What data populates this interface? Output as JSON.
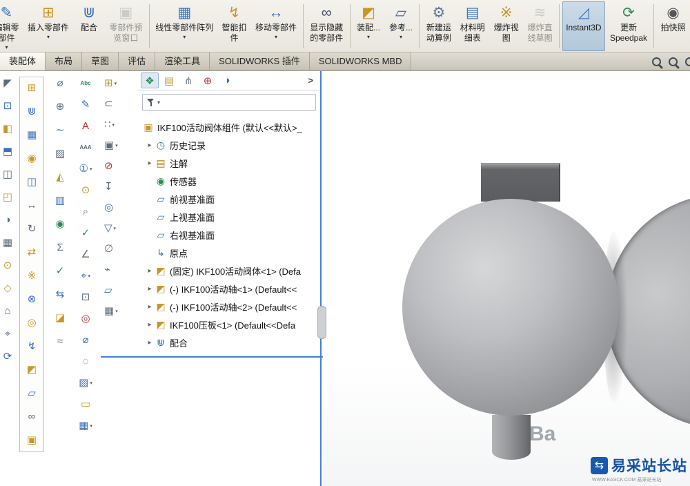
{
  "ribbon": {
    "buttons": [
      {
        "name": "edit-component",
        "label": "编辑零部件",
        "lines": [
          "编辑零",
          "部件"
        ],
        "glyph": "✎",
        "color": "#3a6ebc",
        "arrow": true
      },
      {
        "name": "insert-components",
        "label": "插入零部件",
        "lines": [
          "插入零部件"
        ],
        "glyph": "⊞",
        "color": "#c8962a",
        "arrow": true
      },
      {
        "name": "mate",
        "label": "配合",
        "lines": [
          "配合"
        ],
        "glyph": "⋓",
        "color": "#3a6ebc",
        "arrow": false
      },
      {
        "name": "component-preview-window",
        "label": "零部件预览窗口",
        "lines": [
          "零部件预",
          "览窗口"
        ],
        "glyph": "▣",
        "color": "#9aa0a6",
        "arrow": false,
        "disabled": true
      },
      {
        "name": "linear-component-pattern",
        "label": "线性零部件阵列",
        "lines": [
          "线性零部件阵列"
        ],
        "glyph": "▦",
        "color": "#3a6ebc",
        "arrow": true
      },
      {
        "name": "smart-fasteners",
        "label": "智能扣件",
        "lines": [
          "智能扣",
          "件"
        ],
        "glyph": "↯",
        "color": "#c8962a",
        "arrow": false
      },
      {
        "name": "move-component",
        "label": "移动零部件",
        "lines": [
          "移动零部件"
        ],
        "glyph": "↔",
        "color": "#3a6ebc",
        "arrow": true
      },
      {
        "name": "show-hidden-components",
        "label": "显示隐藏的零部件",
        "lines": [
          "显示隐藏",
          "的零部件"
        ],
        "glyph": "∞",
        "color": "#44506a",
        "arrow": false
      },
      {
        "name": "assembly-features",
        "label": "装配...",
        "lines": [
          "装配..."
        ],
        "glyph": "◩",
        "color": "#c8962a",
        "arrow": true
      },
      {
        "name": "reference-geometry",
        "label": "参考...",
        "lines": [
          "参考..."
        ],
        "glyph": "▱",
        "color": "#3a6ebc",
        "arrow": true
      },
      {
        "name": "new-motion-study",
        "label": "新建运动算例",
        "lines": [
          "新建运",
          "动算例"
        ],
        "glyph": "⚙",
        "color": "#5b7a9a",
        "arrow": false
      },
      {
        "name": "bill-of-materials",
        "label": "材料明细表",
        "lines": [
          "材料明",
          "细表"
        ],
        "glyph": "▤",
        "color": "#3a6ebc",
        "arrow": false
      },
      {
        "name": "exploded-view",
        "label": "爆炸视图",
        "lines": [
          "爆炸视",
          "图"
        ],
        "glyph": "※",
        "color": "#c8962a",
        "arrow": false
      },
      {
        "name": "explode-line-sketch",
        "label": "爆炸直线草图",
        "lines": [
          "爆炸直",
          "线草图"
        ],
        "glyph": "≋",
        "color": "#9aa0a6",
        "arrow": false,
        "disabled": true
      },
      {
        "name": "instant3d",
        "label": "Instant3D",
        "lines": [
          "Instant3D"
        ],
        "glyph": "◿",
        "color": "#3a6ebc",
        "arrow": false,
        "active": true
      },
      {
        "name": "update-speedpak",
        "label": "更新 Speedpak",
        "lines": [
          "更新",
          "Speedpak"
        ],
        "glyph": "⟳",
        "color": "#2e8b57",
        "arrow": false
      },
      {
        "name": "take-snapshot",
        "label": "拍快照",
        "lines": [
          "拍快照"
        ],
        "glyph": "◉",
        "color": "#555555",
        "arrow": false
      }
    ],
    "separators_after": [
      3,
      6,
      7,
      9,
      13,
      15
    ]
  },
  "tabs": {
    "items": [
      {
        "name": "assembly",
        "label": "装配体",
        "active": true
      },
      {
        "name": "layout",
        "label": "布局",
        "active": false
      },
      {
        "name": "sketch",
        "label": "草图",
        "active": false
      },
      {
        "name": "evaluate",
        "label": "评估",
        "active": false
      },
      {
        "name": "render-tools",
        "label": "渲染工具",
        "active": false
      },
      {
        "name": "solidworks-addins",
        "label": "SOLIDWORKS 插件",
        "active": false
      },
      {
        "name": "solidworks-mbd",
        "label": "SOLIDWORKS MBD",
        "active": false
      }
    ],
    "right_icons": [
      {
        "name": "search-commands"
      },
      {
        "name": "zoom-magnifier"
      },
      {
        "name": "magnify-partial"
      }
    ]
  },
  "left_toolbars": {
    "col_a": [
      {
        "n": "select-tool",
        "g": "◤",
        "c": "#5b6b7b"
      },
      {
        "n": "zoom-to-fit",
        "g": "⊡",
        "c": "#3a6ebc"
      },
      {
        "n": "section-view",
        "g": "◧",
        "c": "#c8962a"
      },
      {
        "n": "view-orientation",
        "g": "⬒",
        "c": "#3a6ebc"
      },
      {
        "n": "display-style",
        "g": "◫",
        "c": "#5b6b7b"
      },
      {
        "n": "hide-components",
        "g": "◰",
        "c": "#c8962a"
      },
      {
        "n": "appearance",
        "g": "◑",
        "c": "#3a6ebc"
      },
      {
        "n": "scene",
        "g": "▦",
        "c": "#5b6b7b"
      },
      {
        "n": "camera-views",
        "g": "⊙",
        "c": "#c8962a"
      },
      {
        "n": "lights",
        "g": "◇",
        "c": "#c8962a"
      },
      {
        "n": "standard-views",
        "g": "⌂",
        "c": "#3a6ebc"
      },
      {
        "n": "pan-view",
        "g": "⌖",
        "c": "#5b6b7b"
      },
      {
        "n": "rotate-view",
        "g": "⟳",
        "c": "#3a6ebc"
      }
    ],
    "col_b": [
      {
        "n": "insert-component-tool",
        "g": "⊞",
        "c": "#c8962a"
      },
      {
        "n": "mate-tool",
        "g": "⋓",
        "c": "#3a6ebc"
      },
      {
        "n": "linear-pattern-tool",
        "g": "▦",
        "c": "#3a6ebc"
      },
      {
        "n": "circular-pattern-tool",
        "g": "◉",
        "c": "#c8962a"
      },
      {
        "n": "mirror-components",
        "g": "◫",
        "c": "#3a6ebc"
      },
      {
        "n": "move-component-tool",
        "g": "↔",
        "c": "#5b6b7b"
      },
      {
        "n": "rotate-component-tool",
        "g": "↻",
        "c": "#5b6b7b"
      },
      {
        "n": "replace-components",
        "g": "⇄",
        "c": "#c8962a"
      },
      {
        "n": "exploded-view-tool",
        "g": "※",
        "c": "#c8962a"
      },
      {
        "n": "interference-detection",
        "g": "⊗",
        "c": "#3a6ebc"
      },
      {
        "n": "hole-wizard",
        "g": "◎",
        "c": "#c8962a"
      },
      {
        "n": "smart-fasteners-tool",
        "g": "↯",
        "c": "#3a6ebc"
      },
      {
        "n": "assembly-features-tool",
        "g": "◩",
        "c": "#c8962a"
      },
      {
        "n": "reference-plane-tool",
        "g": "▱",
        "c": "#3a6ebc"
      },
      {
        "n": "belt-chain",
        "g": "∞",
        "c": "#5b6b7b"
      },
      {
        "n": "large-assembly-mode",
        "g": "▣",
        "c": "#c8962a"
      }
    ],
    "col_c": [
      {
        "n": "measure",
        "g": "⌀",
        "c": "#3a6ebc"
      },
      {
        "n": "mass-properties",
        "g": "⊕",
        "c": "#5b6b7b"
      },
      {
        "n": "curvature",
        "g": "∼",
        "c": "#3a6ebc"
      },
      {
        "n": "zebra-stripes",
        "g": "▨",
        "c": "#5b6b7b"
      },
      {
        "n": "draft-analysis",
        "g": "◭",
        "c": "#c8962a"
      },
      {
        "n": "thickness-analysis",
        "g": "▥",
        "c": "#3a6ebc"
      },
      {
        "n": "sensor-tool",
        "g": "◉",
        "c": "#2e8b57"
      },
      {
        "n": "statistics",
        "g": "Σ",
        "c": "#5b6b7b"
      },
      {
        "n": "check-entity",
        "g": "✓",
        "c": "#2e8b57"
      },
      {
        "n": "compare-documents",
        "g": "⇆",
        "c": "#3a6ebc"
      },
      {
        "n": "section-properties",
        "g": "◪",
        "c": "#c8962a"
      },
      {
        "n": "deviation-analysis",
        "g": "≈",
        "c": "#5b6b7b"
      }
    ],
    "col_d": [
      {
        "n": "spell-checker",
        "g": "Abc",
        "c": "#2e8b57"
      },
      {
        "n": "format-painter",
        "g": "✎",
        "c": "#3a6ebc"
      },
      {
        "n": "note",
        "g": "A",
        "c": "#c03030"
      },
      {
        "n": "multi-jog-note",
        "g": "AAA",
        "c": "#5b6b7b"
      },
      {
        "n": "balloon",
        "g": "①",
        "c": "#3a6ebc",
        "a": true
      },
      {
        "n": "auto-balloon",
        "g": "⊙",
        "c": "#c8962a"
      },
      {
        "n": "magnifying-glass",
        "g": "⌕",
        "c": "#5b6b7b"
      },
      {
        "n": "surface-finish",
        "g": "✓",
        "c": "#2e8b57"
      },
      {
        "n": "weld-symbol",
        "g": "∠",
        "c": "#5b6b7b"
      },
      {
        "n": "geometric-tolerance",
        "g": "⌖",
        "c": "#3a6ebc",
        "a": true
      },
      {
        "n": "datum-feature",
        "g": "⊡",
        "c": "#5b6b7b"
      },
      {
        "n": "datum-target",
        "g": "◎",
        "c": "#c03030"
      },
      {
        "n": "hole-callout",
        "g": "⌀",
        "c": "#3a6ebc"
      },
      {
        "n": "revision-symbol",
        "g": "◌",
        "c": "#5b6b7b"
      },
      {
        "n": "area-hatch",
        "g": "▨",
        "c": "#3a6ebc",
        "a": true
      },
      {
        "n": "blocks",
        "g": "▭",
        "c": "#c8962a"
      },
      {
        "n": "tables",
        "g": "▦",
        "c": "#3a6ebc",
        "a": true
      }
    ],
    "col_e": [
      {
        "n": "design-library",
        "g": "⊞",
        "c": "#c8962a",
        "a": true
      },
      {
        "n": "attachments",
        "g": "⊂",
        "c": "#5b6b7b"
      },
      {
        "n": "component-pattern",
        "g": "∷",
        "c": "#3a6ebc",
        "a": true
      },
      {
        "n": "copy-settings",
        "g": "▣",
        "c": "#5b6b7b",
        "a": true
      },
      {
        "n": "filter-off",
        "g": "⊘",
        "c": "#c03030"
      },
      {
        "n": "pin-toolbar",
        "g": "↧",
        "c": "#5b6b7b"
      },
      {
        "n": "isolate",
        "g": "◎",
        "c": "#3a6ebc"
      },
      {
        "n": "selection-filter",
        "g": "▽",
        "c": "#5b6b7b",
        "a": true
      },
      {
        "n": "hide-all-types",
        "g": "∅",
        "c": "#5b6b7b"
      },
      {
        "n": "quick-snaps",
        "g": "⌁",
        "c": "#3a6ebc"
      },
      {
        "n": "show-planes",
        "g": "▱",
        "c": "#3a6ebc"
      },
      {
        "n": "grid-settings",
        "g": "▦",
        "c": "#5b6b7b",
        "a": true
      }
    ]
  },
  "feature_tree": {
    "panel_tabs": [
      {
        "name": "featuremanager-design-tree",
        "glyph": "❖",
        "color": "#2e8b57",
        "active": true
      },
      {
        "name": "property-manager",
        "glyph": "▤",
        "color": "#c8962a",
        "active": false
      },
      {
        "name": "configuration-manager",
        "glyph": "⋔",
        "color": "#6b7a8a",
        "active": false
      },
      {
        "name": "dimxpert-manager",
        "glyph": "⊕",
        "color": "#b23b3b",
        "active": false
      },
      {
        "name": "display-manager",
        "glyph": "◑",
        "color": "#3a6ebc",
        "active": false
      }
    ],
    "collapse_glyph": ">",
    "items": [
      {
        "label": "IKF100活动阀体组件 (默认<<默认>_",
        "icon": "assembly-root",
        "glyph": "▣",
        "color": "#c8962a",
        "level": 0,
        "arrow": false
      },
      {
        "label": "历史记录",
        "icon": "history-folder",
        "glyph": "◷",
        "color": "#3a6ebc",
        "level": 1,
        "arrow": true
      },
      {
        "label": "注解",
        "icon": "annotations-folder",
        "glyph": "▤",
        "color": "#b8860b",
        "level": 1,
        "arrow": true
      },
      {
        "label": "传感器",
        "icon": "sensors-folder",
        "glyph": "◉",
        "color": "#2e8b57",
        "level": 1,
        "arrow": false
      },
      {
        "label": "前视基准面",
        "icon": "front-plane",
        "glyph": "▱",
        "color": "#3a6ebc",
        "level": 1,
        "arrow": false
      },
      {
        "label": "上视基准面",
        "icon": "top-plane",
        "glyph": "▱",
        "color": "#3a6ebc",
        "level": 1,
        "arrow": false
      },
      {
        "label": "右视基准面",
        "icon": "right-plane",
        "glyph": "▱",
        "color": "#3a6ebc",
        "level": 1,
        "arrow": false
      },
      {
        "label": "原点",
        "icon": "origin",
        "glyph": "↳",
        "color": "#3a6ebc",
        "level": 1,
        "arrow": false
      },
      {
        "label": "(固定) IKF100活动阀体<1> (Defa",
        "icon": "part-component",
        "glyph": "◩",
        "color": "#c8962a",
        "level": 1,
        "arrow": true
      },
      {
        "label": "(-) IKF100活动轴<1> (Default<<",
        "icon": "part-component",
        "glyph": "◩",
        "color": "#c8962a",
        "level": 1,
        "arrow": true
      },
      {
        "label": "(-) IKF100活动轴<2> (Default<<",
        "icon": "part-component",
        "glyph": "◩",
        "color": "#c8962a",
        "level": 1,
        "arrow": true
      },
      {
        "label": "IKF100压板<1> (Default<<Defa",
        "icon": "part-component",
        "glyph": "◩",
        "color": "#c8962a",
        "level": 1,
        "arrow": true
      },
      {
        "label": "配合",
        "icon": "mates-folder",
        "glyph": "⋓",
        "color": "#3a6ebc",
        "level": 1,
        "arrow": true
      }
    ]
  },
  "viewport": {
    "watermark_text": "Ba",
    "logo": {
      "text": "易采站长站",
      "subtext": "WWW.EASCK.COM  易采站长站"
    }
  }
}
